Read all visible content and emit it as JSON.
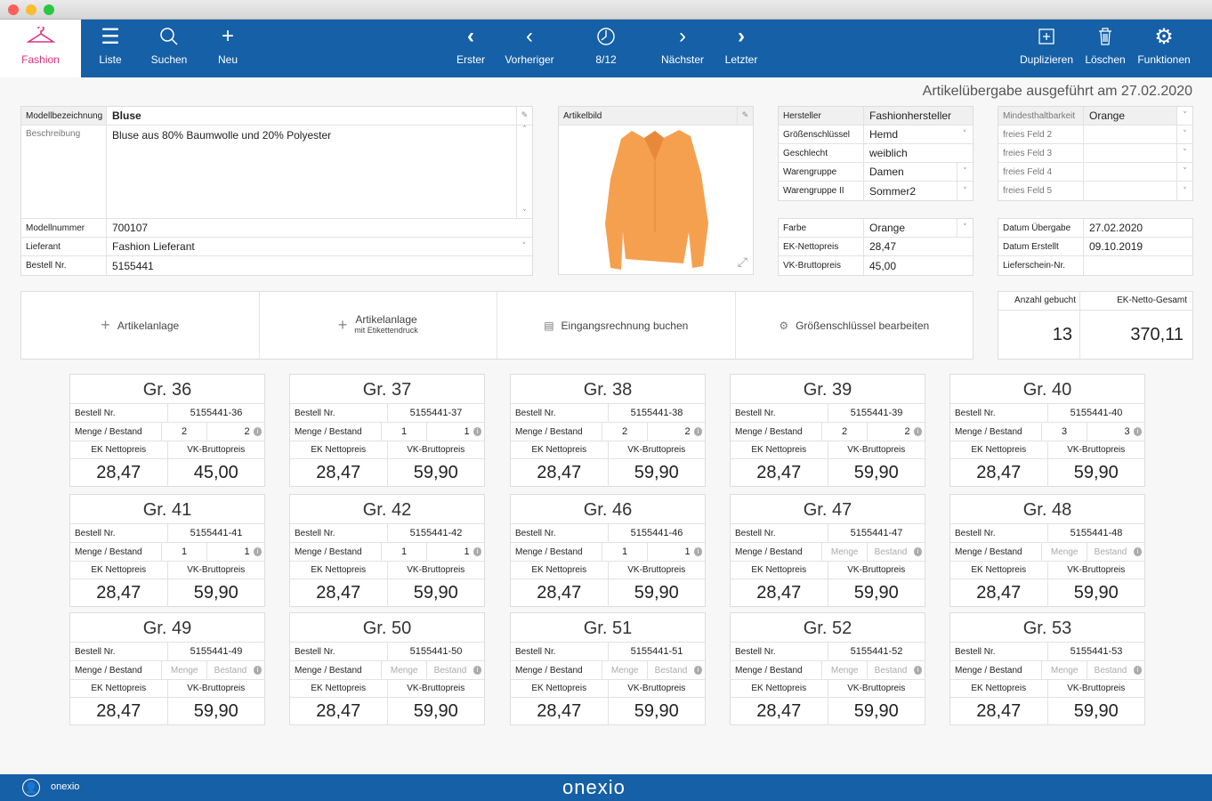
{
  "toolbar": {
    "fashion": "Fashion",
    "liste": "Liste",
    "suchen": "Suchen",
    "neu": "Neu",
    "erster": "Erster",
    "vorheriger": "Vorheriger",
    "position": "8/12",
    "naechster": "Nächster",
    "letzter": "Letzter",
    "duplizieren": "Duplizieren",
    "loeschen": "Löschen",
    "funktionen": "Funktionen"
  },
  "status": "Artikelübergabe ausgeführt am 27.02.2020",
  "model": {
    "bezeichnung_label": "Modellbezeichnung",
    "bezeichnung": "Bluse",
    "beschreibung_label": "Beschreibung",
    "beschreibung": "Bluse aus 80% Baumwolle und 20% Polyester",
    "modellnummer_label": "Modellnummer",
    "modellnummer": "700107",
    "lieferant_label": "Lieferant",
    "lieferant": "Fashion Lieferant",
    "bestell_label": "Bestell Nr.",
    "bestell": "5155441"
  },
  "image": {
    "label": "Artikelbild"
  },
  "attrs": {
    "hersteller_label": "Hersteller",
    "hersteller": "Fashionhersteller",
    "groesse_label": "Größenschlüssel",
    "groesse": "Hemd",
    "geschlecht_label": "Geschlecht",
    "geschlecht": "weiblich",
    "wg_label": "Warengruppe",
    "wg": "Damen",
    "wg2_label": "Warengruppe II",
    "wg2": "Sommer2"
  },
  "free": {
    "mhd_label": "Mindesthaltbarkeit",
    "mhd": "Orange",
    "f2": "freies Feld 2",
    "f3": "freies Feld 3",
    "f4": "freies Feld 4",
    "f5": "freies Feld 5"
  },
  "price": {
    "farbe_label": "Farbe",
    "farbe": "Orange",
    "ek_label": "EK-Nettopreis",
    "ek": "28,47",
    "vk_label": "VK-Bruttopreis",
    "vk": "45,00"
  },
  "dates": {
    "uebergabe_label": "Datum Übergabe",
    "uebergabe": "27.02.2020",
    "erstellt_label": "Datum Erstellt",
    "erstellt": "09.10.2019",
    "lieferschein_label": "Lieferschein-Nr."
  },
  "actions": {
    "a1": "Artikelanlage",
    "a2": "Artikelanlage",
    "a2sub": "mit Etikettendruck",
    "a3": "Eingangsrechnung buchen",
    "a4": "Größenschlüssel bearbeiten"
  },
  "totals": {
    "anzahl_label": "Anzahl gebucht",
    "anzahl": "13",
    "gesamt_label": "EK-Netto-Gesamt",
    "gesamt": "370,11"
  },
  "card_labels": {
    "bestell": "Bestell Nr.",
    "menge": "Menge / Bestand",
    "ek": "EK Nettopreis",
    "vk": "VK-Bruttopreis",
    "menge_ph": "Menge",
    "bestand_ph": "Bestand"
  },
  "cards": [
    {
      "title": "Gr. 36",
      "nr": "5155441-36",
      "menge": "2",
      "bestand": "2",
      "ek": "28,47",
      "vk": "45,00"
    },
    {
      "title": "Gr. 37",
      "nr": "5155441-37",
      "menge": "1",
      "bestand": "1",
      "ek": "28,47",
      "vk": "59,90"
    },
    {
      "title": "Gr. 38",
      "nr": "5155441-38",
      "menge": "2",
      "bestand": "2",
      "ek": "28,47",
      "vk": "59,90"
    },
    {
      "title": "Gr. 39",
      "nr": "5155441-39",
      "menge": "2",
      "bestand": "2",
      "ek": "28,47",
      "vk": "59,90"
    },
    {
      "title": "Gr. 40",
      "nr": "5155441-40",
      "menge": "3",
      "bestand": "3",
      "ek": "28,47",
      "vk": "59,90"
    },
    {
      "title": "Gr. 41",
      "nr": "5155441-41",
      "menge": "1",
      "bestand": "1",
      "ek": "28,47",
      "vk": "59,90"
    },
    {
      "title": "Gr. 42",
      "nr": "5155441-42",
      "menge": "1",
      "bestand": "1",
      "ek": "28,47",
      "vk": "59,90"
    },
    {
      "title": "Gr. 46",
      "nr": "5155441-46",
      "menge": "1",
      "bestand": "1",
      "ek": "28,47",
      "vk": "59,90"
    },
    {
      "title": "Gr. 47",
      "nr": "5155441-47",
      "menge": "",
      "bestand": "",
      "ek": "28,47",
      "vk": "59,90"
    },
    {
      "title": "Gr. 48",
      "nr": "5155441-48",
      "menge": "",
      "bestand": "",
      "ek": "28,47",
      "vk": "59,90"
    },
    {
      "title": "Gr. 49",
      "nr": "5155441-49",
      "menge": "",
      "bestand": "",
      "ek": "28,47",
      "vk": "59,90"
    },
    {
      "title": "Gr. 50",
      "nr": "5155441-50",
      "menge": "",
      "bestand": "",
      "ek": "28,47",
      "vk": "59,90"
    },
    {
      "title": "Gr. 51",
      "nr": "5155441-51",
      "menge": "",
      "bestand": "",
      "ek": "28,47",
      "vk": "59,90"
    },
    {
      "title": "Gr. 52",
      "nr": "5155441-52",
      "menge": "",
      "bestand": "",
      "ek": "28,47",
      "vk": "59,90"
    },
    {
      "title": "Gr. 53",
      "nr": "5155441-53",
      "menge": "",
      "bestand": "",
      "ek": "28,47",
      "vk": "59,90"
    }
  ],
  "footer": {
    "user": "onexio",
    "brand": "onexio"
  },
  "colors": {
    "brand": "#1560a6",
    "accent": "#e0307f",
    "shirt": "#f5a04f"
  }
}
